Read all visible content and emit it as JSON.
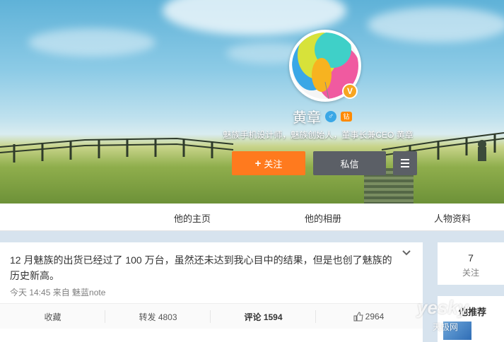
{
  "profile": {
    "name": "黄章",
    "verified_badge": "V",
    "gender_icon": "male-icon",
    "level_icon": "vip-icon",
    "level_text": "钻",
    "bio": "魅族手机设计师，魅族创始人，董事长兼CEO 黄章"
  },
  "buttons": {
    "follow": "关注",
    "follow_icon": "plus-icon",
    "message": "私信",
    "more_icon": "menu-icon"
  },
  "nav": {
    "tabs": [
      "他的主页",
      "他的相册",
      "人物资料"
    ]
  },
  "post": {
    "text": "12 月魅族的出货已经过了 100 万台，虽然还未达到我心目中的结果，但是也创了魅族的历史新高。",
    "meta": "今天 14:45 来自 魅蓝note",
    "actions": {
      "favorite": "收藏",
      "repost": "转发 4803",
      "comment": "评论 1594",
      "like": "2964"
    }
  },
  "sidebar": {
    "following_count": "7",
    "following_label": "关注",
    "recommend_title": "他推荐"
  },
  "watermark": {
    "main": "yesky",
    "sub": "天极网"
  },
  "colors": {
    "follow_button": "#ff7a1e",
    "message_button": "#5b5f66",
    "verified": "#f7a521"
  }
}
